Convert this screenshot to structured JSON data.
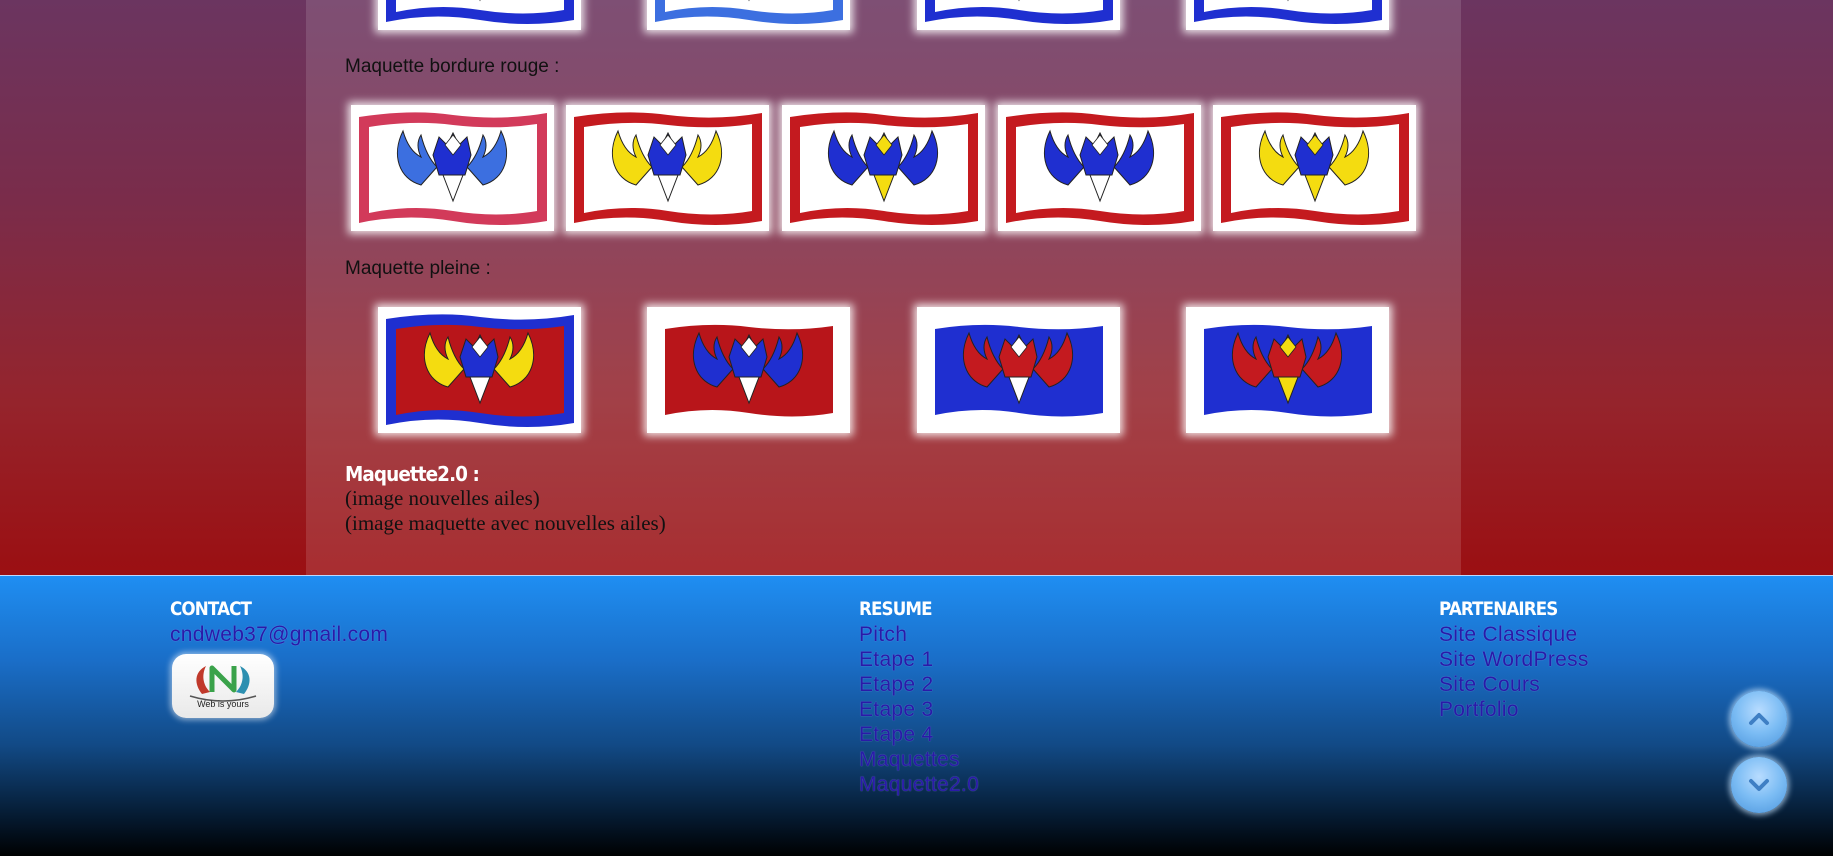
{
  "sections": {
    "bordure_rouge_label": "Maquette bordure rouge :",
    "pleine_label": "Maquette pleine :"
  },
  "maquette2": {
    "title": "Maquette2.0 :",
    "line1": "(image nouvelles ailes)",
    "line2": "(image maquette avec nouvelles ailes)"
  },
  "footer": {
    "contact": {
      "title": "CONTACT",
      "email": "cndweb37@gmail.com",
      "logo_caption": "Web is yours"
    },
    "resume": {
      "title": "RESUME",
      "links": [
        "Pitch",
        "Etape 1",
        "Etape 2",
        "Etape 3",
        "Etape 4",
        "Maquettes",
        "Maquette2.0"
      ]
    },
    "partenaires": {
      "title": "PARTENAIRES",
      "links": [
        "Site Classique",
        "Site WordPress",
        "Site Cours",
        "Portfolio"
      ]
    }
  },
  "controls": {
    "scroll_up_icon": "chevron-up-icon",
    "scroll_down_icon": "chevron-down-icon"
  },
  "colors": {
    "blue": "#1f2fd0",
    "light_blue": "#3c6fe0",
    "red": "#b8151a",
    "pink_red": "#d23a5a",
    "yellow": "#f4dc10",
    "white": "#ffffff"
  },
  "flags": {
    "top_row": [
      {
        "border": "#1f2fd0",
        "wings": "#f4dc10"
      },
      {
        "border": "#3c6fe0",
        "wings": "#c8151a"
      },
      {
        "border": "#1f2fd0",
        "wings": "#c8151a"
      },
      {
        "border": "#1f2fd0",
        "wings": "#f4dc10"
      }
    ],
    "bordure_rouge": [
      {
        "field": "#ffffff",
        "border": "#d23a5a",
        "wings": "#3c6fe0",
        "head": "#1f2fd0",
        "crest": "#ffffff",
        "beak": "#ffffff"
      },
      {
        "field": "#ffffff",
        "border": "#c41a1f",
        "wings": "#f4dc10",
        "head": "#1f2fd0",
        "crest": "#ffffff",
        "beak": "#ffffff"
      },
      {
        "field": "#ffffff",
        "border": "#c41a1f",
        "wings": "#1f2fd0",
        "head": "#1f2fd0",
        "crest": "#f4dc10",
        "beak": "#f4dc10"
      },
      {
        "field": "#ffffff",
        "border": "#c41a1f",
        "wings": "#1f2fd0",
        "head": "#1f2fd0",
        "crest": "#ffffff",
        "beak": "#ffffff"
      },
      {
        "field": "#ffffff",
        "border": "#c41a1f",
        "wings": "#f4dc10",
        "head": "#1f2fd0",
        "crest": "#f4dc10",
        "beak": "#f4dc10"
      }
    ],
    "pleine": [
      {
        "field": "#b8151a",
        "border": "#1f2fd0",
        "wings": "#f4dc10",
        "head": "#1f2fd0",
        "crest": "#ffffff",
        "beak": "#ffffff"
      },
      {
        "field": "#b8151a",
        "border": "#ffffff",
        "wings": "#1f2fd0",
        "head": "#1f2fd0",
        "crest": "#ffffff",
        "beak": "#ffffff"
      },
      {
        "field": "#1f2fd0",
        "border": "#ffffff",
        "wings": "#c41a1f",
        "head": "#c41a1f",
        "crest": "#ffffff",
        "beak": "#ffffff"
      },
      {
        "field": "#1f2fd0",
        "border": "#ffffff",
        "wings": "#c41a1f",
        "head": "#c41a1f",
        "crest": "#f4dc10",
        "beak": "#f4dc10"
      }
    ]
  }
}
